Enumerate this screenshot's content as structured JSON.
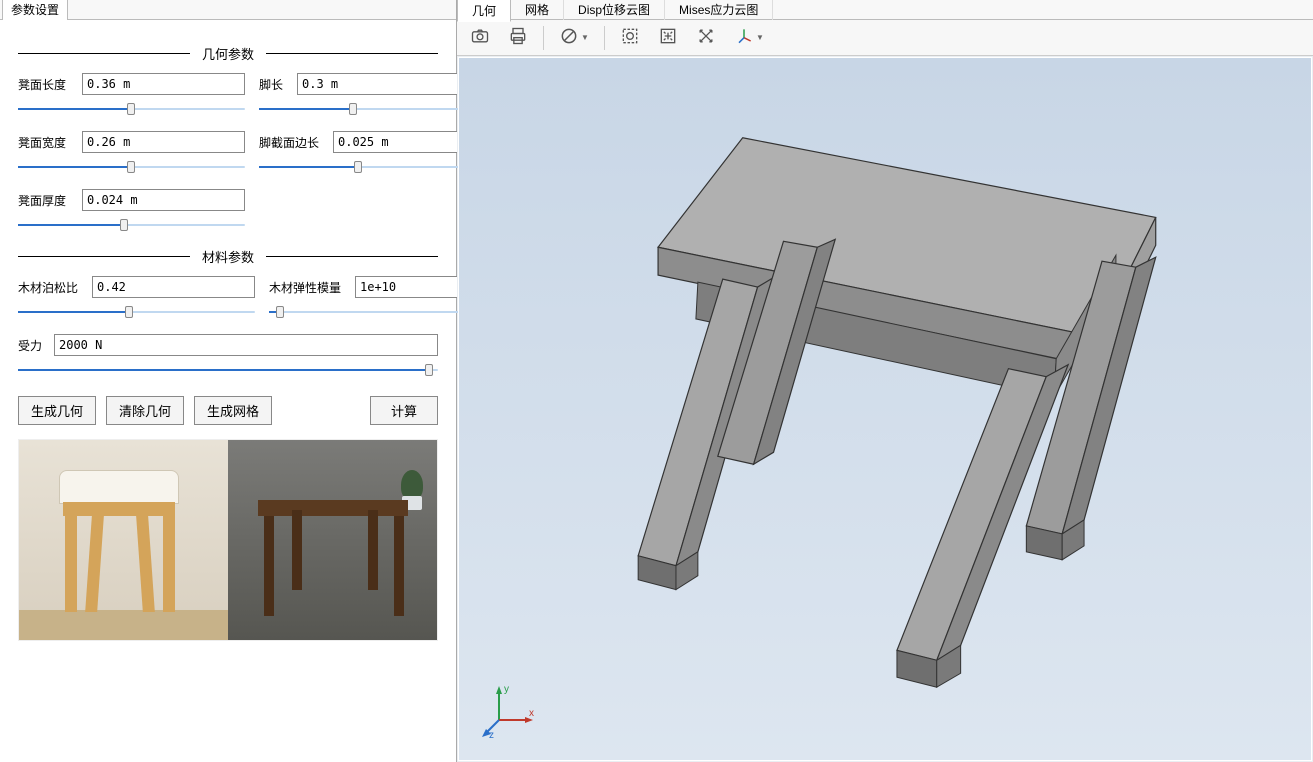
{
  "left": {
    "tab": "参数设置",
    "section_geom": "几何参数",
    "section_mat": "材料参数",
    "params": {
      "seat_len": {
        "label": "凳面长度",
        "value": "0.36 m"
      },
      "leg_len": {
        "label": "脚长",
        "value": "0.3 m"
      },
      "seat_wid": {
        "label": "凳面宽度",
        "value": "0.26 m"
      },
      "leg_sec": {
        "label": "脚截面边长",
        "value": "0.025 m"
      },
      "seat_thk": {
        "label": "凳面厚度",
        "value": "0.024 m"
      },
      "poisson": {
        "label": "木材泊松比",
        "value": "0.42"
      },
      "youngs": {
        "label": "木材弹性模量",
        "value": "1e+10"
      },
      "force": {
        "label": "受力",
        "value": "2000 N"
      }
    },
    "buttons": {
      "gen_geom": "生成几何",
      "clear_geom": "清除几何",
      "gen_mesh": "生成网格",
      "compute": "计算"
    }
  },
  "right": {
    "tabs": {
      "geom": "几何",
      "mesh": "网格",
      "disp": "Disp位移云图",
      "mises": "Mises应力云图"
    },
    "triad": {
      "x": "x",
      "y": "y",
      "z": "z"
    }
  }
}
